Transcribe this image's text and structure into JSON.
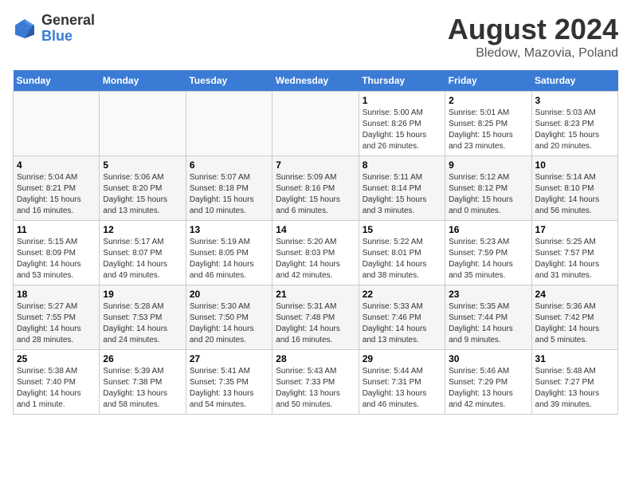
{
  "header": {
    "logo": {
      "general": "General",
      "blue": "Blue"
    },
    "title": "August 2024",
    "subtitle": "Bledow, Mazovia, Poland"
  },
  "days_of_week": [
    "Sunday",
    "Monday",
    "Tuesday",
    "Wednesday",
    "Thursday",
    "Friday",
    "Saturday"
  ],
  "weeks": [
    [
      {
        "num": "",
        "info": ""
      },
      {
        "num": "",
        "info": ""
      },
      {
        "num": "",
        "info": ""
      },
      {
        "num": "",
        "info": ""
      },
      {
        "num": "1",
        "info": "Sunrise: 5:00 AM\nSunset: 8:26 PM\nDaylight: 15 hours\nand 26 minutes."
      },
      {
        "num": "2",
        "info": "Sunrise: 5:01 AM\nSunset: 8:25 PM\nDaylight: 15 hours\nand 23 minutes."
      },
      {
        "num": "3",
        "info": "Sunrise: 5:03 AM\nSunset: 8:23 PM\nDaylight: 15 hours\nand 20 minutes."
      }
    ],
    [
      {
        "num": "4",
        "info": "Sunrise: 5:04 AM\nSunset: 8:21 PM\nDaylight: 15 hours\nand 16 minutes."
      },
      {
        "num": "5",
        "info": "Sunrise: 5:06 AM\nSunset: 8:20 PM\nDaylight: 15 hours\nand 13 minutes."
      },
      {
        "num": "6",
        "info": "Sunrise: 5:07 AM\nSunset: 8:18 PM\nDaylight: 15 hours\nand 10 minutes."
      },
      {
        "num": "7",
        "info": "Sunrise: 5:09 AM\nSunset: 8:16 PM\nDaylight: 15 hours\nand 6 minutes."
      },
      {
        "num": "8",
        "info": "Sunrise: 5:11 AM\nSunset: 8:14 PM\nDaylight: 15 hours\nand 3 minutes."
      },
      {
        "num": "9",
        "info": "Sunrise: 5:12 AM\nSunset: 8:12 PM\nDaylight: 15 hours\nand 0 minutes."
      },
      {
        "num": "10",
        "info": "Sunrise: 5:14 AM\nSunset: 8:10 PM\nDaylight: 14 hours\nand 56 minutes."
      }
    ],
    [
      {
        "num": "11",
        "info": "Sunrise: 5:15 AM\nSunset: 8:09 PM\nDaylight: 14 hours\nand 53 minutes."
      },
      {
        "num": "12",
        "info": "Sunrise: 5:17 AM\nSunset: 8:07 PM\nDaylight: 14 hours\nand 49 minutes."
      },
      {
        "num": "13",
        "info": "Sunrise: 5:19 AM\nSunset: 8:05 PM\nDaylight: 14 hours\nand 46 minutes."
      },
      {
        "num": "14",
        "info": "Sunrise: 5:20 AM\nSunset: 8:03 PM\nDaylight: 14 hours\nand 42 minutes."
      },
      {
        "num": "15",
        "info": "Sunrise: 5:22 AM\nSunset: 8:01 PM\nDaylight: 14 hours\nand 38 minutes."
      },
      {
        "num": "16",
        "info": "Sunrise: 5:23 AM\nSunset: 7:59 PM\nDaylight: 14 hours\nand 35 minutes."
      },
      {
        "num": "17",
        "info": "Sunrise: 5:25 AM\nSunset: 7:57 PM\nDaylight: 14 hours\nand 31 minutes."
      }
    ],
    [
      {
        "num": "18",
        "info": "Sunrise: 5:27 AM\nSunset: 7:55 PM\nDaylight: 14 hours\nand 28 minutes."
      },
      {
        "num": "19",
        "info": "Sunrise: 5:28 AM\nSunset: 7:53 PM\nDaylight: 14 hours\nand 24 minutes."
      },
      {
        "num": "20",
        "info": "Sunrise: 5:30 AM\nSunset: 7:50 PM\nDaylight: 14 hours\nand 20 minutes."
      },
      {
        "num": "21",
        "info": "Sunrise: 5:31 AM\nSunset: 7:48 PM\nDaylight: 14 hours\nand 16 minutes."
      },
      {
        "num": "22",
        "info": "Sunrise: 5:33 AM\nSunset: 7:46 PM\nDaylight: 14 hours\nand 13 minutes."
      },
      {
        "num": "23",
        "info": "Sunrise: 5:35 AM\nSunset: 7:44 PM\nDaylight: 14 hours\nand 9 minutes."
      },
      {
        "num": "24",
        "info": "Sunrise: 5:36 AM\nSunset: 7:42 PM\nDaylight: 14 hours\nand 5 minutes."
      }
    ],
    [
      {
        "num": "25",
        "info": "Sunrise: 5:38 AM\nSunset: 7:40 PM\nDaylight: 14 hours\nand 1 minute."
      },
      {
        "num": "26",
        "info": "Sunrise: 5:39 AM\nSunset: 7:38 PM\nDaylight: 13 hours\nand 58 minutes."
      },
      {
        "num": "27",
        "info": "Sunrise: 5:41 AM\nSunset: 7:35 PM\nDaylight: 13 hours\nand 54 minutes."
      },
      {
        "num": "28",
        "info": "Sunrise: 5:43 AM\nSunset: 7:33 PM\nDaylight: 13 hours\nand 50 minutes."
      },
      {
        "num": "29",
        "info": "Sunrise: 5:44 AM\nSunset: 7:31 PM\nDaylight: 13 hours\nand 46 minutes."
      },
      {
        "num": "30",
        "info": "Sunrise: 5:46 AM\nSunset: 7:29 PM\nDaylight: 13 hours\nand 42 minutes."
      },
      {
        "num": "31",
        "info": "Sunrise: 5:48 AM\nSunset: 7:27 PM\nDaylight: 13 hours\nand 39 minutes."
      }
    ]
  ]
}
